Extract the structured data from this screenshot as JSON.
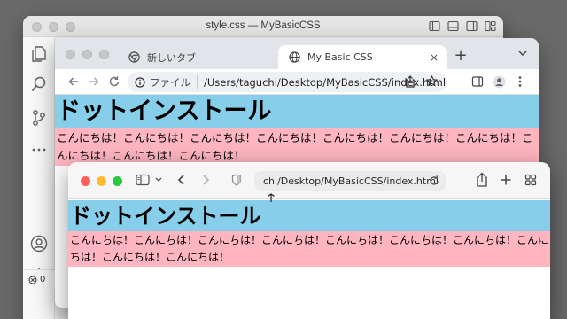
{
  "vscode": {
    "title": "style.css — MyBasicCSS",
    "status_errors": "0"
  },
  "chrome": {
    "tabs": [
      {
        "label": "新しいタブ",
        "active": false
      },
      {
        "label": "My Basic CSS",
        "active": true
      }
    ],
    "new_tab": "+",
    "close": "×",
    "protocol": "ファイル",
    "url": "/Users/taguchi/Desktop/MyBasicCSS/index.html"
  },
  "safari": {
    "url": "chi/Desktop/MyBasicCSS/index.html"
  },
  "page": {
    "heading": "ドットインストール",
    "paragraph": "こんにちは！こんにちは！こんにちは！こんにちは！こんにちは！こんにちは！こんにちは！こんにちは！こんにちは！こんにちは！"
  },
  "colors": {
    "heading_bg": "#87ceeb",
    "paragraph_bg": "#ffb6c1",
    "safari_close": "#fe5f57",
    "safari_minimize": "#febc2e",
    "safari_zoom": "#28c840"
  }
}
